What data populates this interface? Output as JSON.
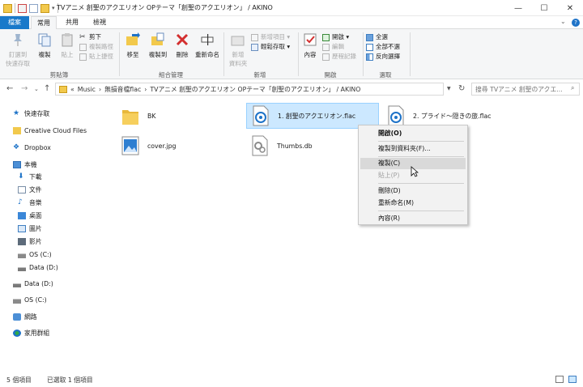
{
  "window": {
    "title": "TVアニメ 創聖のアクエリオン OPテーマ「創聖のアクエリオン」 / AKINO",
    "minimize": "—",
    "maximize": "☐",
    "close": "✕"
  },
  "tabs": [
    {
      "label": "檔案"
    },
    {
      "label": "常用"
    },
    {
      "label": "共用"
    },
    {
      "label": "檢視"
    }
  ],
  "ribbon": {
    "clipboard": {
      "label": "剪貼簿",
      "pin_line1": "釘選到",
      "pin_line2": "快速存取",
      "copy": "複製",
      "paste": "貼上",
      "cut": "剪下",
      "copy_path": "複製路徑",
      "paste_shortcut": "貼上捷徑"
    },
    "organize": {
      "label": "組合管理",
      "move_to": "移至",
      "copy_to": "複製到",
      "delete": "刪除",
      "rename": "重新命名"
    },
    "new": {
      "label": "新增",
      "new_folder_line1": "新增",
      "new_folder_line2": "資料夾",
      "new_item": "新增項目 ▾",
      "easy_access": "輕鬆存取 ▾"
    },
    "open": {
      "label": "開啟",
      "properties": "內容",
      "open": "開啟 ▾",
      "edit": "編輯",
      "history": "歷程記錄"
    },
    "select": {
      "label": "選取",
      "select_all": "全選",
      "select_none": "全部不選",
      "invert": "反向選擇"
    }
  },
  "address": {
    "back": "←",
    "forward": "→",
    "dropdown": "⌄",
    "up": "↑",
    "crumbs": [
      "«",
      "Music",
      "›",
      "無損音檔flac",
      "›",
      "TVアニメ 創聖のアクエリオン OPテーマ「創聖のアクエリオン」 / AKINO"
    ],
    "search_placeholder": "搜尋 TVアニメ 創聖のアクエ..."
  },
  "sidebar": [
    {
      "label": "快速存取"
    },
    {
      "label": "Creative Cloud Files"
    },
    {
      "label": "Dropbox"
    },
    {
      "label": "本機"
    },
    {
      "label": "下載"
    },
    {
      "label": "文件"
    },
    {
      "label": "音樂"
    },
    {
      "label": "桌面"
    },
    {
      "label": "圖片"
    },
    {
      "label": "影片"
    },
    {
      "label": "OS (C:)"
    },
    {
      "label": "Data (D:)"
    },
    {
      "label": "Data (D:)"
    },
    {
      "label": "OS (C:)"
    },
    {
      "label": "網路"
    },
    {
      "label": "家用群組"
    }
  ],
  "files": [
    {
      "name": "BK"
    },
    {
      "name": "1. 創聖のアクエリオン.flac"
    },
    {
      "name": "2. プライド～隠きの旅.flac"
    },
    {
      "name": "cover.jpg"
    },
    {
      "name": "Thumbs.db"
    }
  ],
  "context_menu": [
    {
      "label": "開啟(O)"
    },
    {
      "label": "複製到資料夾(F)..."
    },
    {
      "label": "複製(C)"
    },
    {
      "label": "貼上(P)"
    },
    {
      "label": "刪除(D)"
    },
    {
      "label": "重新命名(M)"
    },
    {
      "label": "內容(R)"
    }
  ],
  "status": {
    "count": "5 個項目",
    "selected": "已選取 1 個項目"
  },
  "colors": {
    "accent": "#1979ca",
    "selection": "#cce8ff",
    "folder": "#f2c94c"
  }
}
